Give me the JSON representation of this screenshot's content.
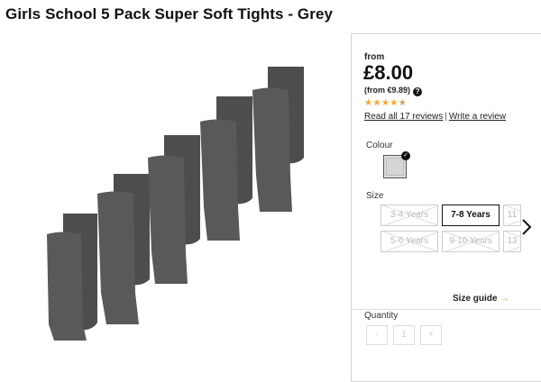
{
  "product": {
    "title": "Girls School 5 Pack Super Soft Tights - Grey",
    "image_alt": "Five pairs of grey tights"
  },
  "pricing": {
    "from_label": "from",
    "price": "£8.00",
    "alt_price": "(from €9.89)",
    "help_icon": "?"
  },
  "rating": {
    "stars_filled": 4,
    "stars_total": 5,
    "reviews_link": "Read all 17 reviews",
    "separator": "|",
    "write_review": "Write a review"
  },
  "colour": {
    "label": "Colour",
    "selected": "Grey",
    "swatch_color": "#d6d6d6"
  },
  "size": {
    "label": "Size",
    "options": [
      {
        "label": "3-4 Years",
        "available": false
      },
      {
        "label": "7-8 Years",
        "available": true,
        "selected": true
      },
      {
        "label": "11",
        "available": false
      },
      {
        "label": "5-6 Years",
        "available": false
      },
      {
        "label": "9-10 Years",
        "available": false
      },
      {
        "label": "13",
        "available": false
      }
    ],
    "next_icon": "chevron-right-icon"
  },
  "size_guide": {
    "label": "Size guide",
    "arrow": "→"
  },
  "quantity": {
    "label": "Quantity",
    "minus": "-",
    "value": "1",
    "plus": "+"
  }
}
